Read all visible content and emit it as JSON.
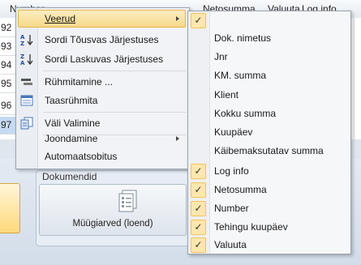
{
  "grid": {
    "headers": [
      {
        "label": "Number"
      },
      {
        "label": "Netosumma"
      },
      {
        "label": "Valuuta"
      },
      {
        "label": "Log info"
      }
    ],
    "rows": [
      "92",
      "93",
      "94",
      "95",
      "96",
      "97"
    ]
  },
  "ribbon": {
    "group_title": "Dokumendid",
    "button_label": "Müügiarved (loend)"
  },
  "menu": {
    "items": [
      {
        "label": "Veerud",
        "has_submenu": true,
        "icon": "none"
      },
      {
        "label": "Sordi Tõusvas Järjestuses",
        "icon": "sort-ascending-icon"
      },
      {
        "label": "Sordi Laskuvas Järjestuses",
        "icon": "sort-descending-icon"
      },
      {
        "label": "Rühmitamine ...",
        "icon": "group-icon"
      },
      {
        "label": "Taasrühmita",
        "icon": "regroup-icon"
      },
      {
        "label": "Väli Valimine",
        "icon": "field-chooser-icon"
      },
      {
        "label": "Joondamine",
        "has_submenu": true,
        "icon": "none"
      },
      {
        "label": "Automaatsobitus",
        "icon": "none"
      }
    ]
  },
  "submenu": {
    "items": [
      {
        "label": "",
        "checked": true
      },
      {
        "label": "Dok. nimetus",
        "checked": false
      },
      {
        "label": "Jnr",
        "checked": false
      },
      {
        "label": "KM. summa",
        "checked": false
      },
      {
        "label": "Klient",
        "checked": false
      },
      {
        "label": "Kokku summa",
        "checked": false
      },
      {
        "label": "Kuupäev",
        "checked": false
      },
      {
        "label": "Käibemaksutatav summa",
        "checked": false
      },
      {
        "label": "Log info",
        "checked": true
      },
      {
        "label": "Netosumma",
        "checked": true
      },
      {
        "label": "Number",
        "checked": true
      },
      {
        "label": "Tehingu kuupäev",
        "checked": true
      },
      {
        "label": "Valuuta",
        "checked": true
      }
    ]
  },
  "colors": {
    "highlight": "#f7d98a",
    "check_bg": "#fde7ad",
    "selected_row": "#c5daf2"
  }
}
